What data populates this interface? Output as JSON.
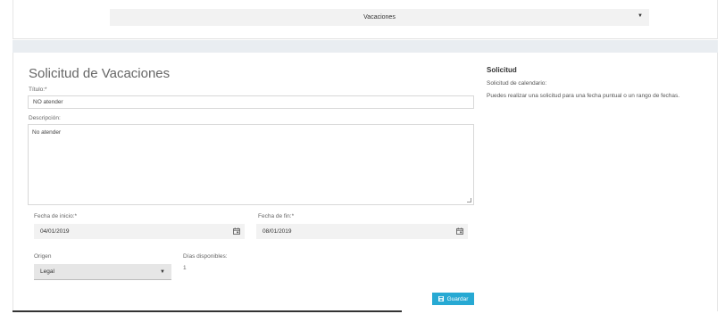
{
  "top": {
    "type_select": "Vacaciones"
  },
  "form": {
    "title": "Solicitud de Vacaciones",
    "titulo_label": "Título:*",
    "titulo_value": "NO atender",
    "descripcion_label": "Descripción:",
    "descripcion_value": "No atender",
    "fecha_inicio_label": "Fecha de inicio:*",
    "fecha_inicio_value": "04/01/2019",
    "fecha_fin_label": "Fecha de fin:*",
    "fecha_fin_value": "08/01/2019",
    "origen_label": "Origen",
    "origen_value": "Legal",
    "dias_label": "Días disponibles:",
    "dias_value": "1",
    "save_label": "Guardar"
  },
  "side": {
    "title": "Solicitud",
    "subtitle": "Solicitud de calendario:",
    "help": "Puedes realizar una solicitud para una fecha puntual o un rango de fechas."
  },
  "colors": {
    "accent": "#27a9d3",
    "band": "#e9edf1",
    "field_bg": "#f2f2f2"
  },
  "icons": {
    "dropdown": "caret-down-icon",
    "calendar": "calendar-icon",
    "save": "floppy-disk-icon"
  }
}
